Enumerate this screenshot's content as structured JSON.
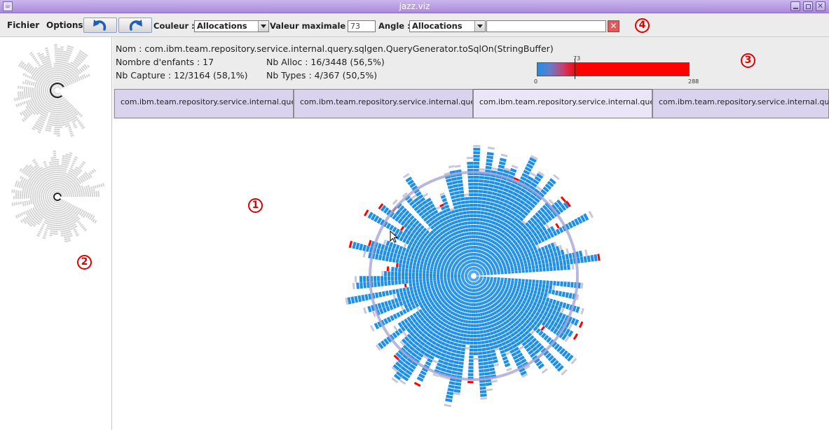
{
  "window": {
    "title": "jazz.viz"
  },
  "menu": {
    "fichier": "Fichier",
    "options": "Options"
  },
  "toolbar": {
    "couleur_label": "Couleur :",
    "couleur_value": "Allocations",
    "vmax_label": "Valeur maximale :",
    "vmax_value": "73",
    "angle_label": "Angle :",
    "angle_value": "Allocations",
    "search_value": ""
  },
  "info": {
    "nom": "Nom : com.ibm.team.repository.service.internal.query.sqlgen.QueryGenerator.toSqlOn(StringBuffer)",
    "enfants": "Nombre d'enfants : 17",
    "capture": "Nb Capture : 12/3164 (58,1%)",
    "alloc": "Nb Alloc : 16/3448 (56,5%)",
    "types": "Nb Types : 4/367 (50,5%)",
    "scale_min": "0",
    "scale_max": "288",
    "scale_value": "73"
  },
  "tabs": [
    {
      "label": "com.ibm.team.repository.service.internal.query.sqlgen"
    },
    {
      "label": "com.ibm.team.repository.service.internal.query.sqlgen"
    },
    {
      "label": "com.ibm.team.repository.service.internal.query.sqlgen"
    },
    {
      "label": "com.ibm.team.repository.service.internal.query.sqlgen"
    }
  ],
  "annotations": {
    "a1": "1",
    "a2": "2",
    "a3": "3",
    "a4": "4"
  },
  "colors": {
    "accent": "#1e8fe8",
    "highlight": "#ff0000",
    "titlebar": "#b89ce4",
    "ring": "#a0a0d0"
  }
}
